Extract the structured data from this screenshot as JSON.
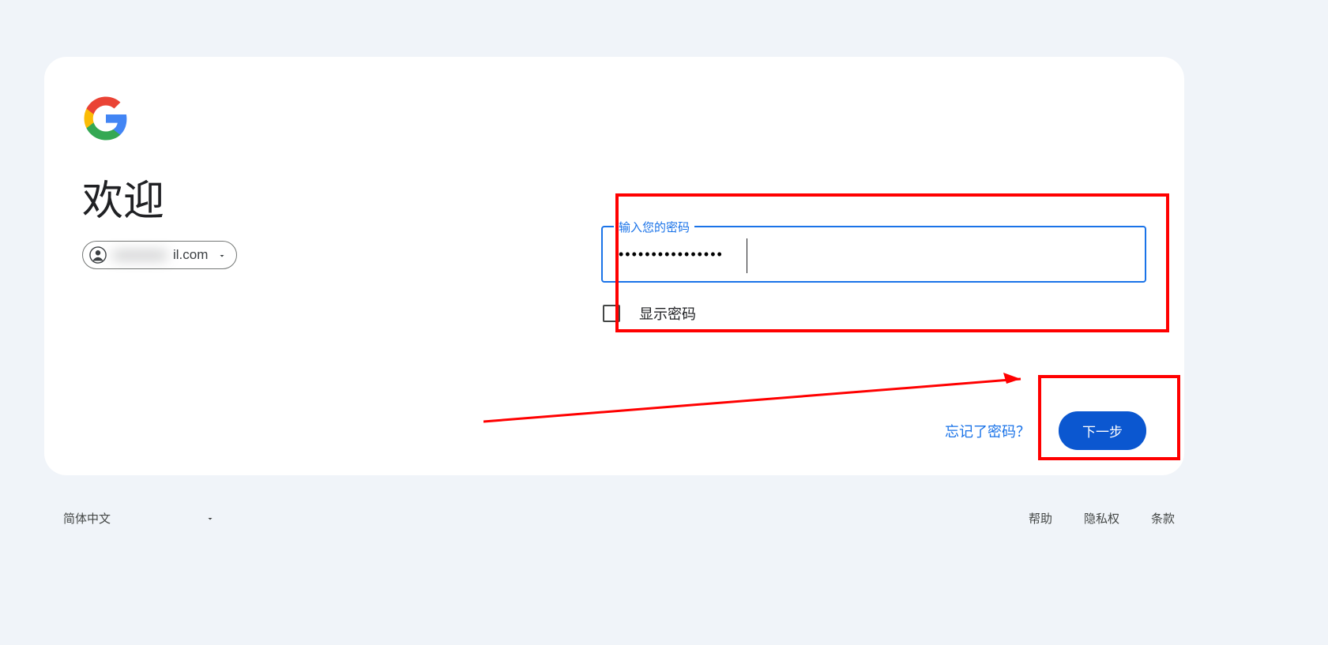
{
  "heading": "欢迎",
  "account": {
    "email_masked": "xxxxxxxx",
    "email_suffix": "il.com"
  },
  "password": {
    "label": "输入您的密码",
    "value": "••••••••••••••••",
    "show_password_label": "显示密码"
  },
  "actions": {
    "forgot_label": "忘记了密码？",
    "next_label": "下一步"
  },
  "footer": {
    "language": "简体中文",
    "links": {
      "help": "帮助",
      "privacy": "隐私权",
      "terms": "条款"
    }
  }
}
